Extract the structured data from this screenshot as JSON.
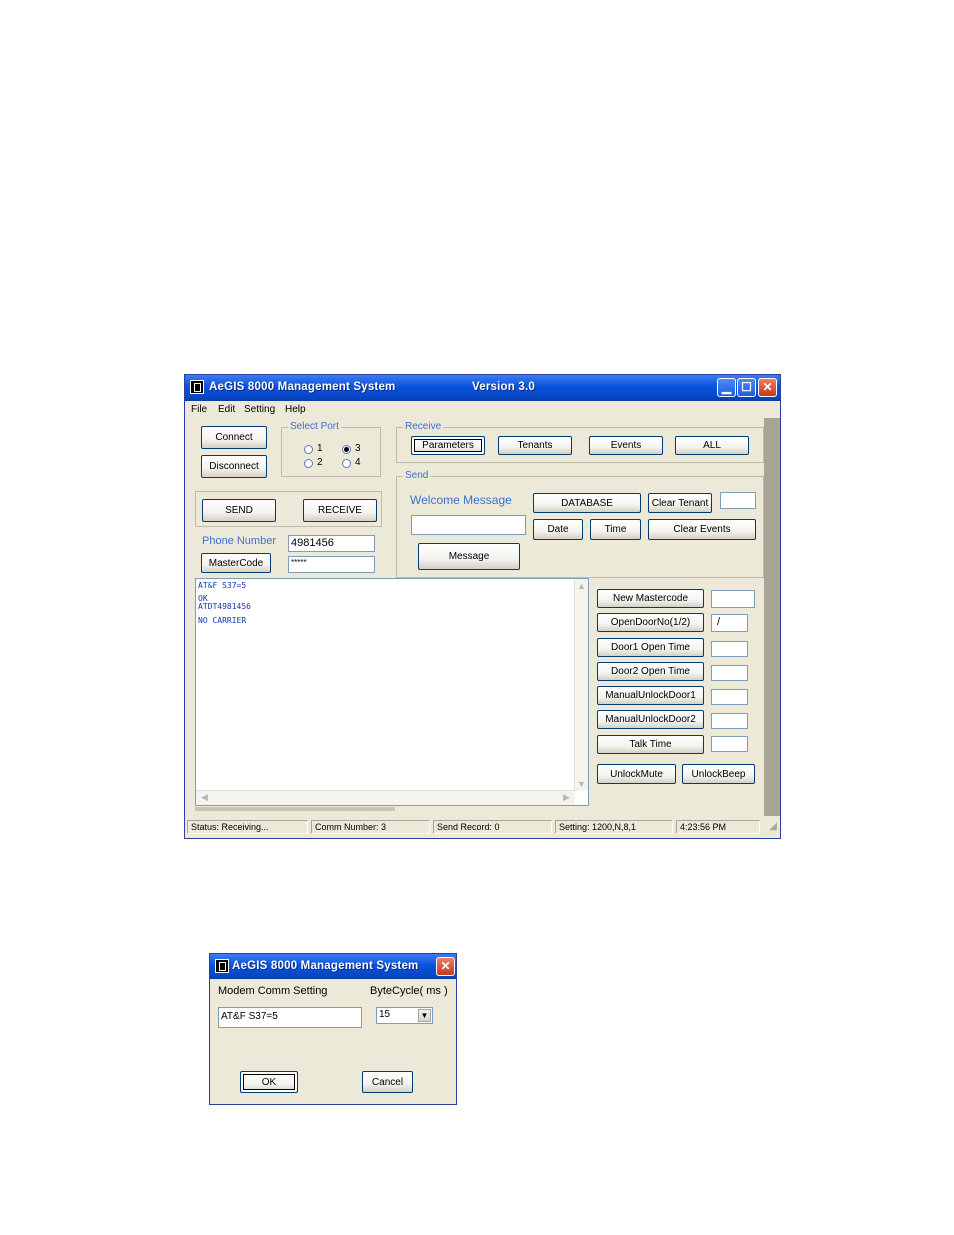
{
  "main_window": {
    "title": "AeGIS 8000 Management System",
    "version": "Version 3.0",
    "menu": [
      "File",
      "Edit",
      "Setting",
      "Help"
    ],
    "connect_label": "Connect",
    "disconnect_label": "Disconnect",
    "select_port": {
      "label": "Select Port",
      "options": [
        "1",
        "2",
        "3",
        "4"
      ],
      "selected": "3"
    },
    "send_label": "SEND",
    "receive_label": "RECEIVE",
    "phone_number_label": "Phone Number",
    "phone_number_value": "4981456",
    "mastercode_label": "MasterCode",
    "mastercode_value": "*****",
    "receive_group": {
      "label": "Receive",
      "buttons": [
        "Parameters",
        "Tenants",
        "Events",
        "ALL"
      ]
    },
    "send_group": {
      "label": "Send",
      "welcome_message_label": "Welcome Message",
      "welcome_message_value": "",
      "message_button": "Message",
      "database_button": "DATABASE",
      "clear_tenant_button": "Clear Tenant",
      "date_button": "Date",
      "time_button": "Time",
      "clear_events_button": "Clear Events"
    },
    "log_lines": [
      "AT&F S37=5",
      "OK",
      "ATDT4981456",
      "NO CARRIER"
    ],
    "settings": [
      {
        "label": "New Mastercode",
        "value": ""
      },
      {
        "label": "OpenDoorNo(1/2)",
        "value": "/"
      },
      {
        "label": "Door1 Open Time",
        "value": ""
      },
      {
        "label": "Door2 Open Time",
        "value": ""
      },
      {
        "label": "ManualUnlockDoor1",
        "value": ""
      },
      {
        "label": "ManualUnlockDoor2",
        "value": ""
      },
      {
        "label": "Talk Time",
        "value": ""
      }
    ],
    "unlock_mute_label": "UnlockMute",
    "unlock_beep_label": "UnlockBeep",
    "status": {
      "status": "Status: Receiving...",
      "comm_number": "Comm Number: 3",
      "send_record": "Send Record: 0",
      "setting": "Setting: 1200,N,8,1",
      "time": "4:23:56 PM"
    }
  },
  "dialog": {
    "title": "AeGIS 8000 Management System",
    "modem_label": "Modem Comm Setting",
    "modem_value": "AT&F S37=5",
    "bytecycle_label": "ByteCycle( ms )",
    "bytecycle_value": "15",
    "ok_label": "OK",
    "cancel_label": "Cancel"
  },
  "colors": {
    "title_blue": "#0a53de",
    "group_label_blue": "#3d6fd1",
    "log_text_blue": "#1535b5",
    "window_face": "#ece9d8"
  }
}
